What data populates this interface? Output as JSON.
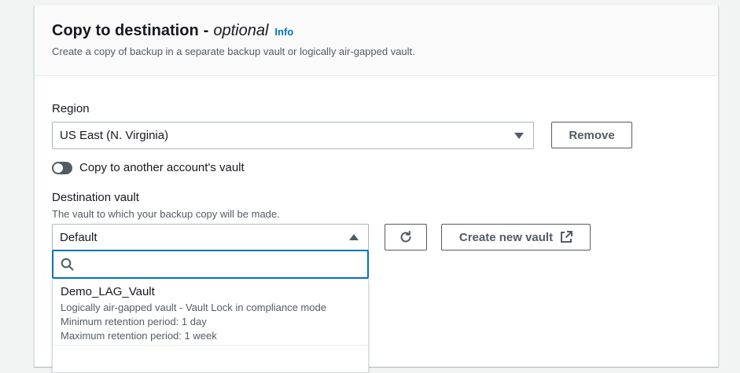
{
  "section": {
    "title": "Copy to destination",
    "title_suffix": "optional",
    "info_label": "Info",
    "subtitle": "Create a copy of backup in a separate backup vault or logically air-gapped vault."
  },
  "region": {
    "label": "Region",
    "selected": "US East (N. Virginia)",
    "remove_label": "Remove"
  },
  "cross_account": {
    "toggle_label": "Copy to another account's vault",
    "enabled": false
  },
  "destination_vault": {
    "label": "Destination vault",
    "description": "The vault to which your backup copy will be made.",
    "selected": "Default",
    "create_label": "Create new vault",
    "search_placeholder": "",
    "options": [
      {
        "name": "Demo_LAG_Vault",
        "details": [
          "Logically air-gapped vault - Vault Lock in compliance mode",
          "Minimum retention period: 1 day",
          "Maximum retention period: 1 week"
        ]
      }
    ]
  },
  "colors": {
    "link": "#0073bb",
    "focus": "#0073bb",
    "text": "#16191f",
    "secondary_text": "#545b64"
  },
  "icons": {
    "dropdown_closed": "caret-down-icon",
    "dropdown_open": "caret-up-icon",
    "refresh": "refresh-icon",
    "external": "external-link-icon",
    "search": "search-icon"
  }
}
